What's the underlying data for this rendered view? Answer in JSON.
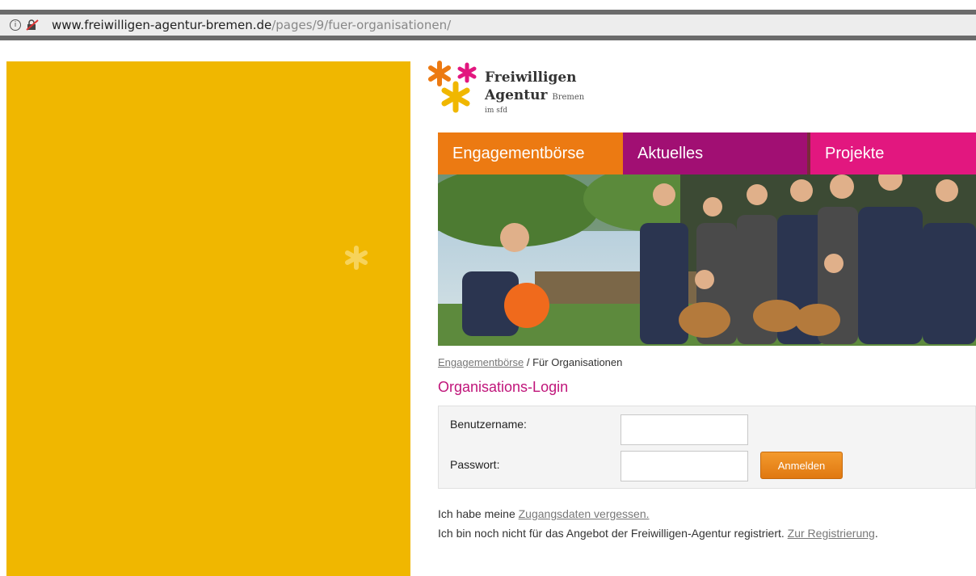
{
  "browser": {
    "url_host": "www.freiwilligen-agentur-bremen.de",
    "url_path": "/pages/9/fuer-organisationen/"
  },
  "logo": {
    "line1": "Freiwilligen",
    "line2": "Agentur",
    "city": "Bremen",
    "sub": "im sfd"
  },
  "nav": {
    "tabs": [
      {
        "label": "Engagementbörse",
        "color": "#ec7a12"
      },
      {
        "label": "Aktuelles",
        "color": "#a10f73"
      },
      {
        "label": "Projekte",
        "color": "#e2177f"
      }
    ]
  },
  "breadcrumb": {
    "link": "Engagementbörse",
    "separator": " / ",
    "current": "Für Organisationen"
  },
  "login": {
    "title": "Organisations-Login",
    "username_label": "Benutzername:",
    "username_value": "",
    "password_label": "Passwort:",
    "password_value": "",
    "submit_label": "Anmelden"
  },
  "info": {
    "line1_prefix": "Ich habe meine ",
    "line1_link": "Zugangsdaten vergessen.",
    "line2_prefix": "Ich bin noch nicht für das Angebot der Freiwilligen-Agentur registriert. ",
    "line2_link": "Zur Registrierung",
    "line2_suffix": "."
  },
  "colors": {
    "side_panel": "#f0b700",
    "accent_orange": "#ec7a12",
    "accent_magenta": "#c0157a"
  }
}
